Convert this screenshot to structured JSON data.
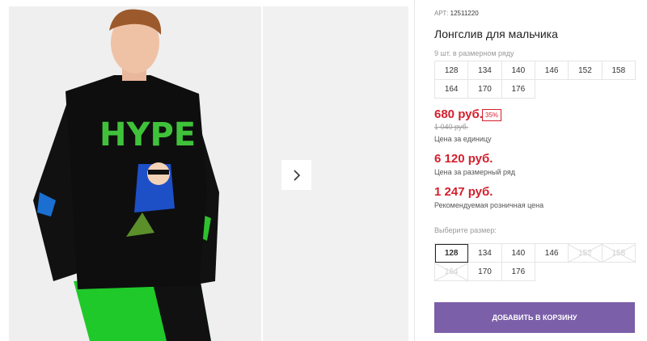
{
  "product": {
    "sku_label": "АРТ:",
    "sku": "12511220",
    "title": "Лонгслив для мальчика",
    "size_count": "9 шт. в размерном ряду",
    "sizes_row": [
      "128",
      "134",
      "140",
      "146",
      "152",
      "158",
      "164",
      "170",
      "176"
    ]
  },
  "price": {
    "current": "680 руб.",
    "discount": "35%",
    "old": "1 040 руб.",
    "unit_label": "Цена за единицу",
    "set_price": "6 120 руб.",
    "set_label": "Цена за размерный ряд",
    "retail_price": "1 247 руб.",
    "retail_label": "Рекомендуемая розничная цена"
  },
  "selector": {
    "label": "Выберите размер:",
    "options": [
      {
        "size": "128",
        "state": "selected"
      },
      {
        "size": "134",
        "state": "available"
      },
      {
        "size": "140",
        "state": "available"
      },
      {
        "size": "146",
        "state": "available"
      },
      {
        "size": "152",
        "state": "disabled"
      },
      {
        "size": "158",
        "state": "disabled"
      },
      {
        "size": "164",
        "state": "disabled"
      },
      {
        "size": "170",
        "state": "available"
      },
      {
        "size": "176",
        "state": "available"
      }
    ]
  },
  "cart_button": "ДОБАВИТЬ В КОРЗИНУ",
  "colors": {
    "price_red": "#d41f2c",
    "button_purple": "#7b5fa9"
  },
  "icons": {
    "next": "chevron-right-icon"
  }
}
